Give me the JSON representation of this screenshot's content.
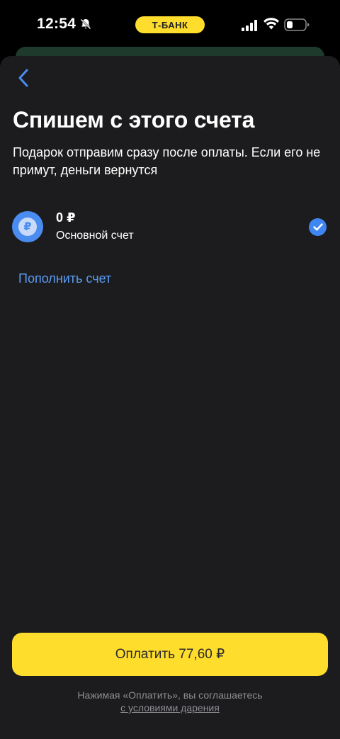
{
  "status_bar": {
    "time": "12:54",
    "bank_label": "Т-БАНК",
    "icons": [
      "bell-slash-icon",
      "signal-icon",
      "wifi-icon",
      "battery-icon"
    ]
  },
  "header": {
    "back_icon": "chevron-left-icon",
    "title": "Спишем с этого счета",
    "subtitle": "Подарок отправим сразу после оплаты. Если его не примут, деньги вернутся"
  },
  "account": {
    "icon": "ruble-icon",
    "icon_glyph": "₽",
    "amount": "0 ₽",
    "name": "Основной счет",
    "selected": true
  },
  "topup_label": "Пополнить счет",
  "pay_button_label": "Оплатить 77,60 ₽",
  "agreement": {
    "text": "Нажимая «Оплатить», вы соглашаетесь",
    "link": "с условиями дарения"
  },
  "colors": {
    "accent_yellow": "#ffdd2d",
    "accent_blue": "#3f86f2",
    "sheet_bg": "#1c1c1e",
    "link_blue": "#5a9cf5"
  }
}
